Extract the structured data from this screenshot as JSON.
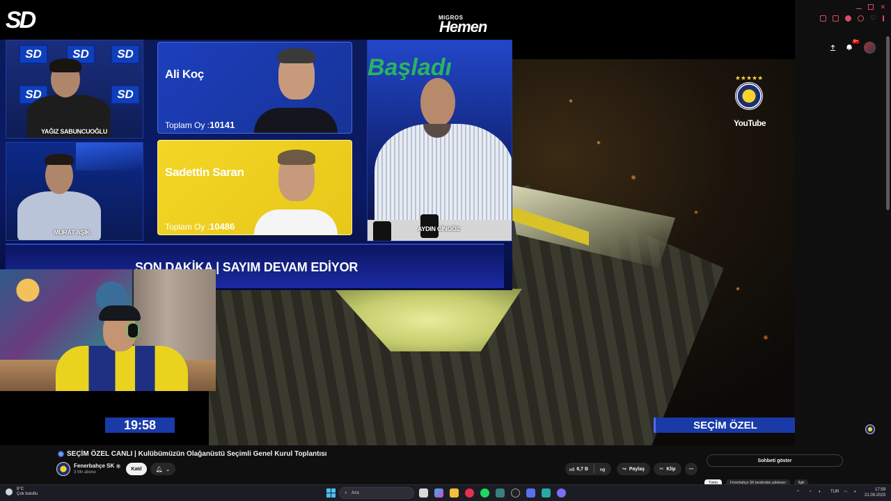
{
  "broadcast": {
    "channel_logo": "SD",
    "sponsor_top": "MIGROS",
    "sponsor_main": "Hemen",
    "backdrop_text": "Başladı",
    "panelists": [
      "YAĞIZ SABUNCUOĞLU",
      "MURAT AŞIK",
      "AYDIN CİNGÖZ"
    ],
    "candidates": [
      {
        "name": "Ali Koç",
        "votes_label": "Toplam Oy :",
        "votes": "10141",
        "color": "#1d3fbe"
      },
      {
        "name": "Sadettin Saran",
        "votes_label": "Toplam Oy :",
        "votes": "10486",
        "color": "#f2d626"
      }
    ],
    "ticker": "SON DAKİKA | SAYIM DEVAM EDİYOR",
    "timer": "19:58",
    "badge": "SEÇİM ÖZEL",
    "club_watermark": "YouTube",
    "tile_text": "SD"
  },
  "video": {
    "title": "SEÇİM ÖZEL CANLI | Kulübümüzün Olağanüstü Seçimli Genel Kurul Toplantısı",
    "channel": "Fenerbahçe SK",
    "subscribers": "3 Mn abone",
    "join_label": "Katıl",
    "like_count": "6,7 B",
    "share_label": "Paylaş",
    "clip_label": "Klip",
    "more_label": "⋯",
    "chat_label": "Sohbeti göster",
    "chips": [
      "Tümü",
      "Fenerbahçe SK tarafından yüklenen",
      "İlgili"
    ]
  },
  "header": {
    "notification_count": "9+"
  },
  "taskbar": {
    "weather_temp": "8°C",
    "weather_desc": "Çok bulutlu",
    "search_placeholder": "Ara",
    "lang": "TUR",
    "time": "17:59",
    "date": "21.09.2025"
  },
  "colors": {
    "fb_navy": "#1f2f6e",
    "fb_yellow": "#f5d52a",
    "broadcast_blue": "#1a3aa8"
  }
}
